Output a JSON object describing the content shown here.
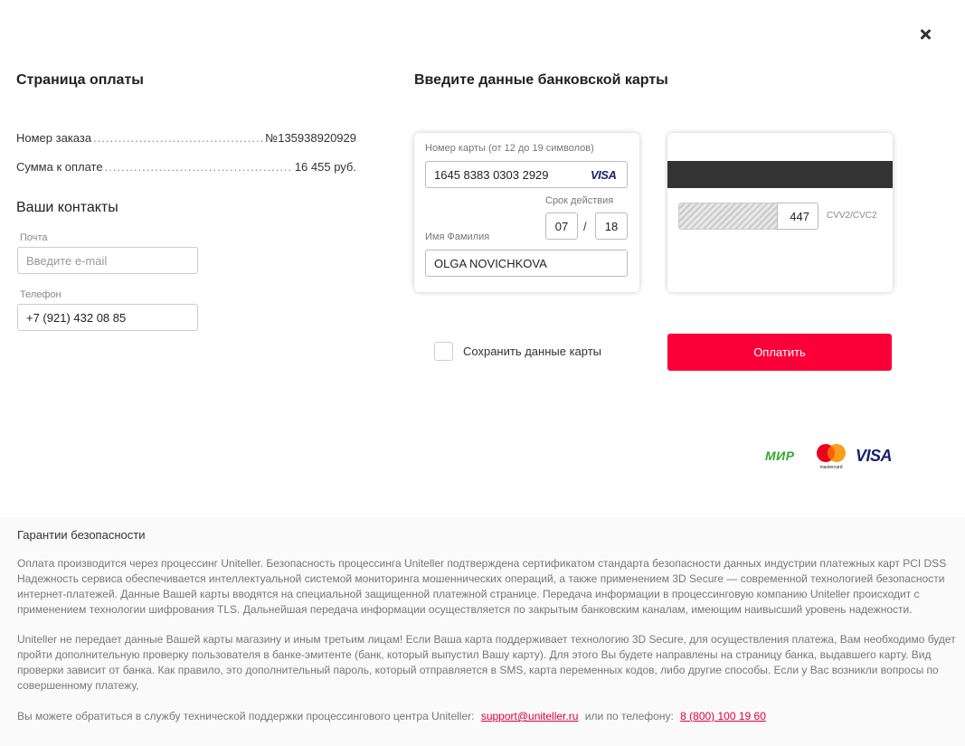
{
  "header": {
    "left_title": "Страница оплаты",
    "right_title": "Введите данные банковской карты"
  },
  "order": {
    "number_label": "Номер заказа",
    "number_value": "№135938920929",
    "sum_label": "Сумма к оплате",
    "sum_value": "16 455 руб."
  },
  "contacts": {
    "title": "Ваши контакты",
    "email_label": "Почта",
    "email_placeholder": "Введите e-mail",
    "email_value": "",
    "phone_label": "Телефон",
    "phone_value": "+7 (921) 432 08 85"
  },
  "card_front": {
    "number_label": "Номер карты (от 12 до 19 символов)",
    "number_value": "1645 8383 0303 2929",
    "brand_icon": "visa-icon",
    "brand_text": "VISA",
    "expiry_label": "Срок действия",
    "expiry_month": "07",
    "expiry_separator": "/",
    "expiry_year": "18",
    "name_label": "Имя Фамилия",
    "name_value": "OLGA NOVICHKOVA"
  },
  "card_back": {
    "cvv_value": "447",
    "cvv_label": "CVV2/CVC2"
  },
  "actions": {
    "save_card_label": "Сохранить данные карты",
    "save_card_checked": false,
    "pay_label": "Оплатить",
    "pay_color": "#fb0038"
  },
  "payment_logos": {
    "mir": "МИР",
    "mastercard": "mastercard",
    "visa": "VISA"
  },
  "security": {
    "title": "Гарантии безопасности",
    "paragraph1": "Оплата производится через процессинг Uniteller. Безопасность процессинга Uniteller подтверждена сертификатом стандарта безопасности данных индустрии платежных карт PCI DSS Надежность сервиса обеспечивается интеллектуальной системой мониторинга мошеннических операций, а также применением 3D Secure — современной технологией безопасности интернет-платежей. Данные Вашей карты вводятся на специальной защищенной платежной странице. Передача информации в процессинговую компанию Uniteller происходит с применением технологии шифрования TLS. Дальнейшая передача информации осуществляется по закрытым банковским каналам, имеющим наивысший уровень надежности.",
    "paragraph2": "Uniteller не передает данные Вашей карты магазину и иным третьим лицам! Если Ваша карта поддерживает технологию 3D Secure, для осуществления платежа, Вам необходимо будет пройти дополнительную проверку пользователя в банке-эмитенте (банк, который выпустил Вашу карту). Для этого Вы будете направлены на страницу банка, выдавшего карту. Вид проверки зависит от банка. Как правило, это дополнительный пароль, который отправляется в SMS, карта переменных кодов, либо другие способы. Если у Вас возникли вопросы по совершенному платежу,",
    "contact_text": "Вы можете обратиться в службу технической поддержки процессингового центра Uniteller:",
    "email_link": "support@uniteller.ru",
    "phone_text": "или по телефону:",
    "phone_link": "8 (800) 100 19 60"
  }
}
